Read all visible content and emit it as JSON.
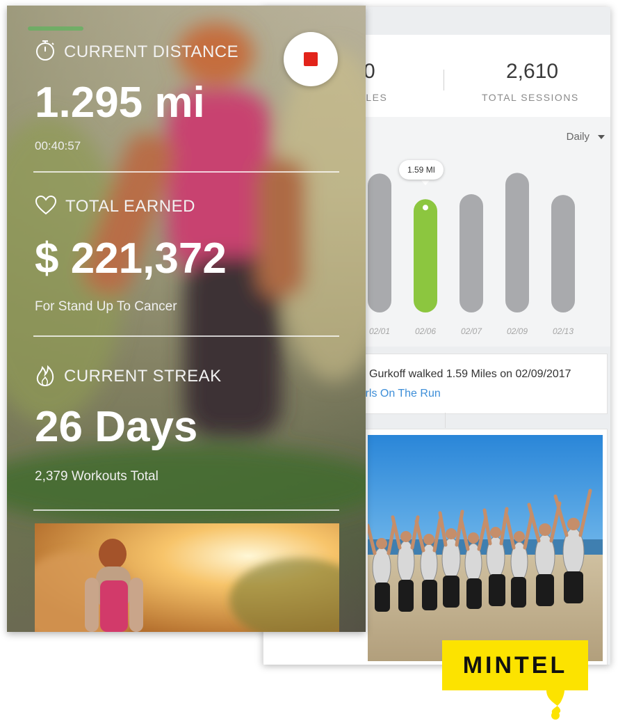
{
  "stats": {
    "miles_value": "0",
    "miles_label": "ILES",
    "sessions_value": "2,610",
    "sessions_label": "TOTAL SESSIONS"
  },
  "chart": {
    "period_select": "Daily",
    "tooltip": "1.59 MI",
    "highlight_index": 1,
    "accent_color": "#8cc63f",
    "bar_color": "#a9aaad"
  },
  "chart_data": {
    "type": "bar",
    "categories": [
      "02/01",
      "02/06",
      "02/07",
      "02/09",
      "02/13"
    ],
    "values": [
      1.95,
      1.59,
      1.66,
      1.96,
      1.65
    ],
    "ylim": [
      0,
      2.1
    ]
  },
  "feed": {
    "text": "Gurkoff walked 1.59 Miles on 02/09/2017",
    "link": "irls On The Run"
  },
  "front": {
    "distance_label": "CURRENT DISTANCE",
    "distance_value": "1.295 mi",
    "elapsed_time": "00:40:57",
    "earned_label": "TOTAL EARNED",
    "earned_value": "$ 221,372",
    "earned_cause": "For Stand Up To Cancer",
    "streak_label": "CURRENT STREAK",
    "streak_value": "26 Days",
    "workouts_total": "2,379 Workouts Total",
    "stop_color": "#e2231a"
  },
  "logo": {
    "text": "MINTEL",
    "color": "#fce300"
  }
}
